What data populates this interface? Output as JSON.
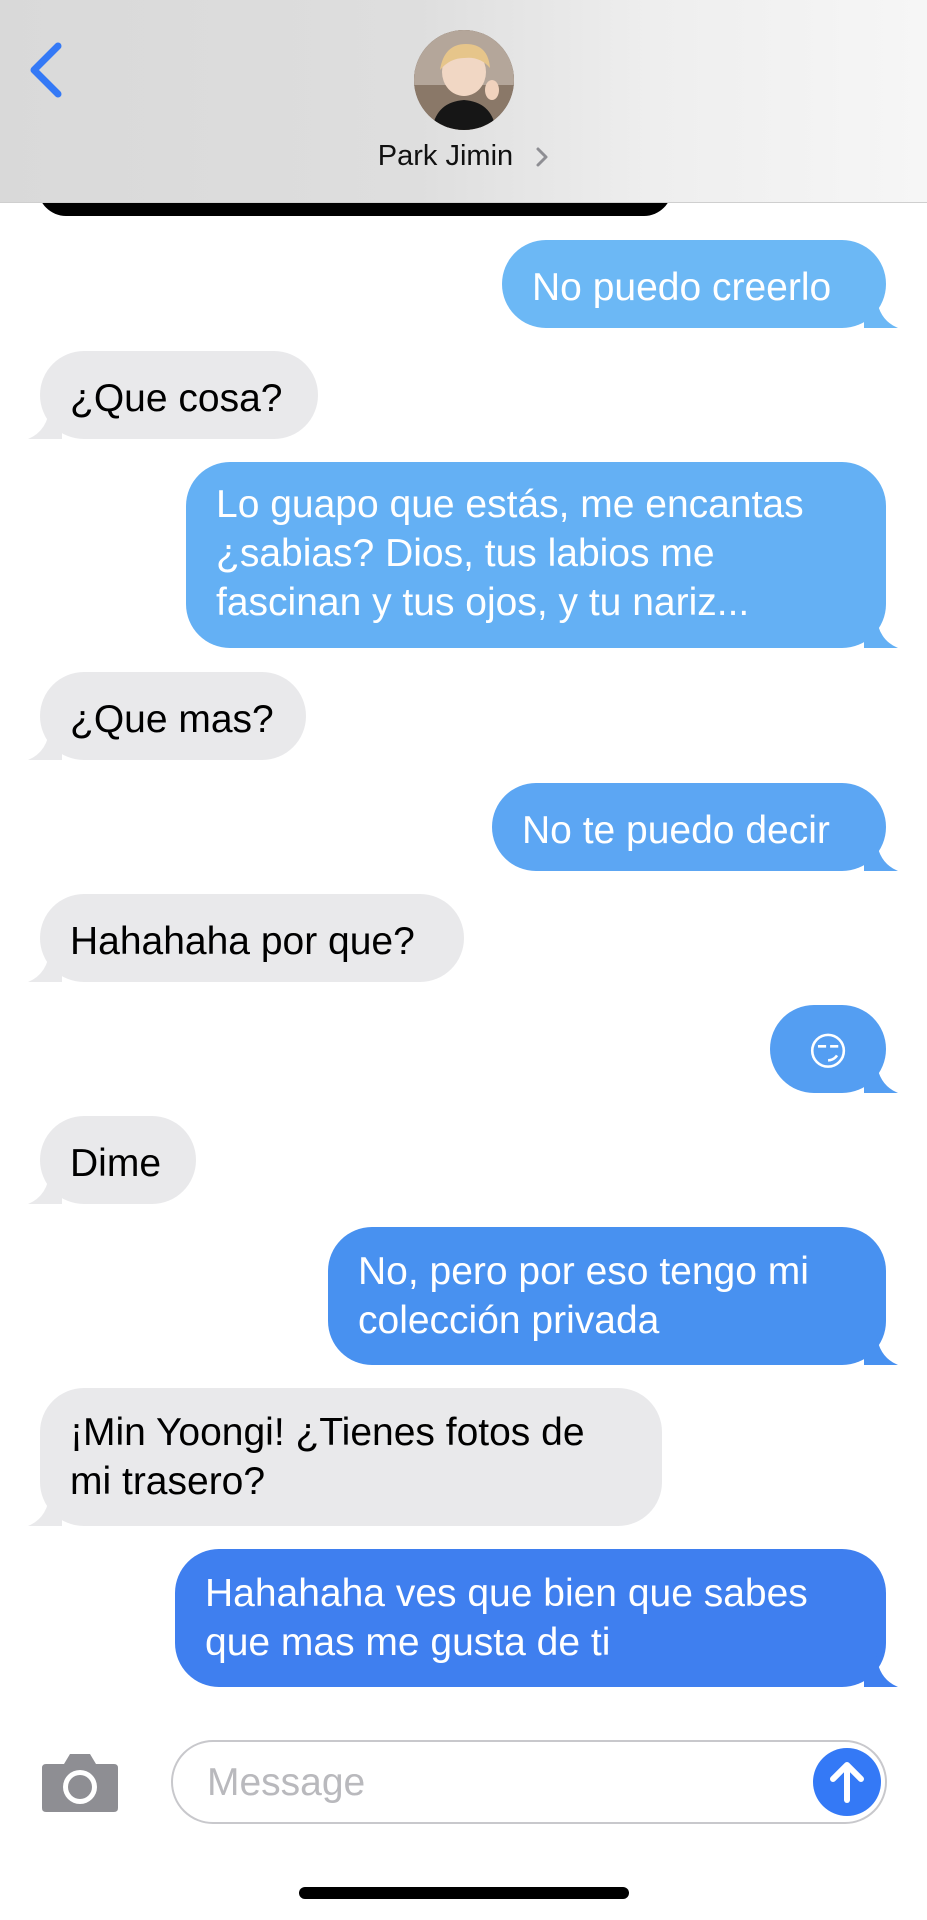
{
  "header": {
    "contact_name": "Park Jimin",
    "back_icon": "chevron-left-icon",
    "detail_icon": "chevron-right-icon"
  },
  "colors": {
    "accent": "#3479f6",
    "received_bubble": "#e9e9eb",
    "sent_top": "#6cb8f5",
    "sent_bottom": "#3f7fef"
  },
  "messages": [
    {
      "from": "me",
      "text": "No puedo creerlo"
    },
    {
      "from": "them",
      "text": "¿Que cosa?"
    },
    {
      "from": "me",
      "text": "Lo guapo que estás, me encantas ¿sabias? Dios, tus labios me fascinan y tus ojos, y tu nariz..."
    },
    {
      "from": "them",
      "text": "¿Que mas?"
    },
    {
      "from": "me",
      "text": "No te puedo decir"
    },
    {
      "from": "them",
      "text": "Hahahaha por que?"
    },
    {
      "from": "me",
      "text": "😏"
    },
    {
      "from": "them",
      "text": "Dime"
    },
    {
      "from": "me",
      "text": "No, pero por eso tengo mi colección privada"
    },
    {
      "from": "them",
      "text": "¡Min Yoongi! ¿Tienes fotos de mi trasero?"
    },
    {
      "from": "me",
      "text": "Hahahaha ves que bien que sabes que mas me gusta de ti"
    }
  ],
  "composer": {
    "placeholder": "Message",
    "camera_icon": "camera-icon",
    "send_icon": "send-arrow-icon"
  }
}
